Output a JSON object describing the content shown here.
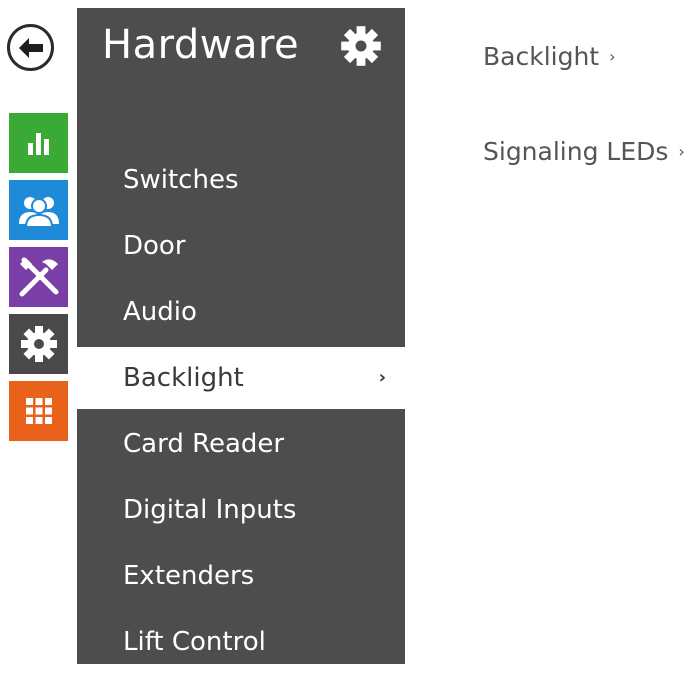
{
  "rail": {
    "back_icon": "arrow-left-icon",
    "items": [
      {
        "name": "status",
        "icon": "bar-chart-icon",
        "color": "#3aa935"
      },
      {
        "name": "directory",
        "icon": "users-icon",
        "color": "#1f8bd8"
      },
      {
        "name": "services",
        "icon": "tools-icon",
        "color": "#7a3fa6"
      },
      {
        "name": "hardware",
        "icon": "gear-icon",
        "color": "#4a4a4a"
      },
      {
        "name": "system",
        "icon": "grid-icon",
        "color": "#e8621c"
      }
    ]
  },
  "sidebar": {
    "title": "Hardware",
    "settings_icon": "gear-icon",
    "background": "#4d4d4d",
    "items": [
      {
        "label": "Switches"
      },
      {
        "label": "Door"
      },
      {
        "label": "Audio"
      },
      {
        "label": "Backlight",
        "active": true,
        "chevron": "›"
      },
      {
        "label": "Card Reader"
      },
      {
        "label": "Digital Inputs"
      },
      {
        "label": "Extenders"
      },
      {
        "label": "Lift Control"
      }
    ]
  },
  "content": {
    "links": [
      {
        "label": "Backlight",
        "chevron": "›"
      },
      {
        "label": "Signaling LEDs",
        "chevron": "›"
      }
    ]
  }
}
